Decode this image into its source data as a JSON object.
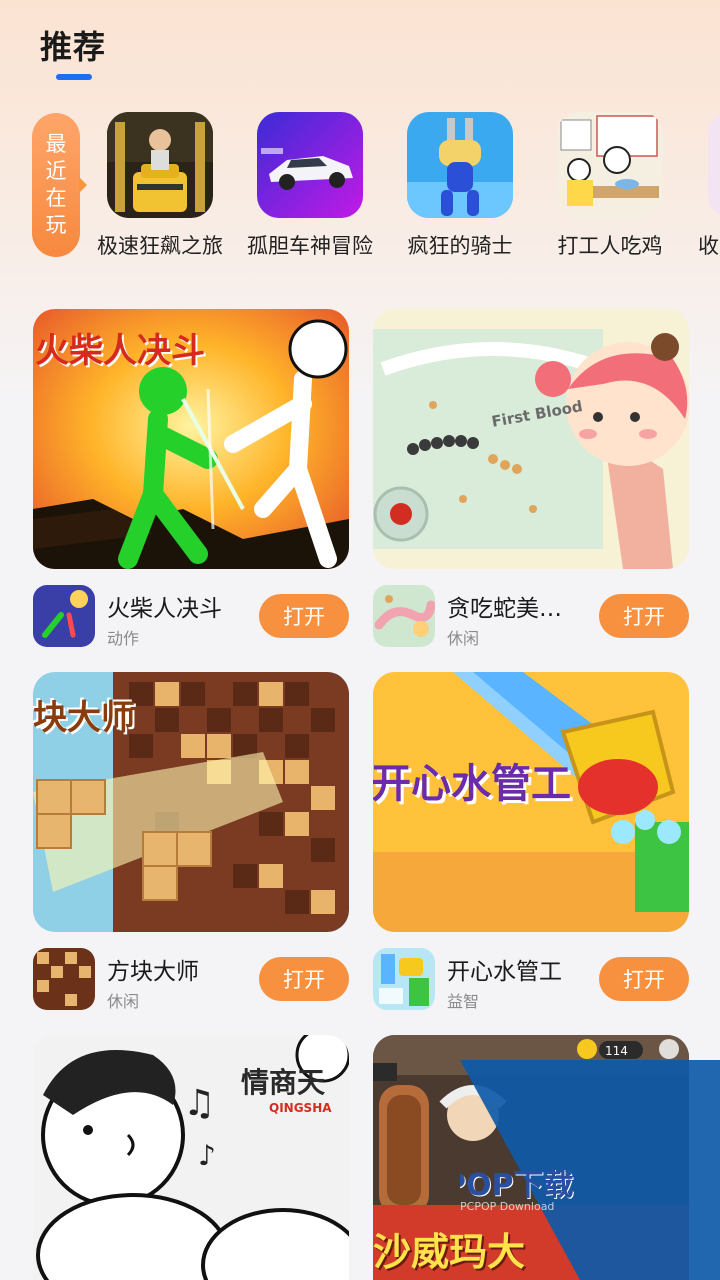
{
  "header": {
    "title": "推荐"
  },
  "recent": {
    "badge_label": "最\n近\n在\n玩",
    "badge_chars": [
      "最",
      "近",
      "在",
      "玩"
    ],
    "items": [
      {
        "name": "极速狂飙之旅",
        "icon": "robot-racer-icon"
      },
      {
        "name": "孤胆车神冒险",
        "icon": "sports-car-icon"
      },
      {
        "name": "疯狂的骑士",
        "icon": "plug-runner-icon"
      },
      {
        "name": "打工人吃鸡",
        "icon": "office-meme-icon"
      },
      {
        "name": "收",
        "icon": "partial-icon"
      }
    ]
  },
  "cards": [
    {
      "banner_text": "火柴人决斗",
      "name": "火柴人决斗",
      "category": "动作",
      "button": "打开"
    },
    {
      "banner_text": "First Blood",
      "name": "贪吃蛇美…",
      "category": "休闲",
      "button": "打开"
    },
    {
      "banner_text": "块大师",
      "name": "方块大师",
      "category": "休闲",
      "button": "打开"
    },
    {
      "banner_text": "开心水管工",
      "name": "开心水管工",
      "category": "益智",
      "button": "打开"
    },
    {
      "banner_text": "情商天",
      "banner_subtext": "QINGSHA"
    },
    {
      "banner_text": "沙威玛大",
      "counter": "114"
    }
  ],
  "watermark": {
    "brand": "PCPOP下载",
    "sub": "PCPOP Download"
  },
  "colors": {
    "accent": "#f7903f",
    "underline": "#1e6ff0"
  }
}
